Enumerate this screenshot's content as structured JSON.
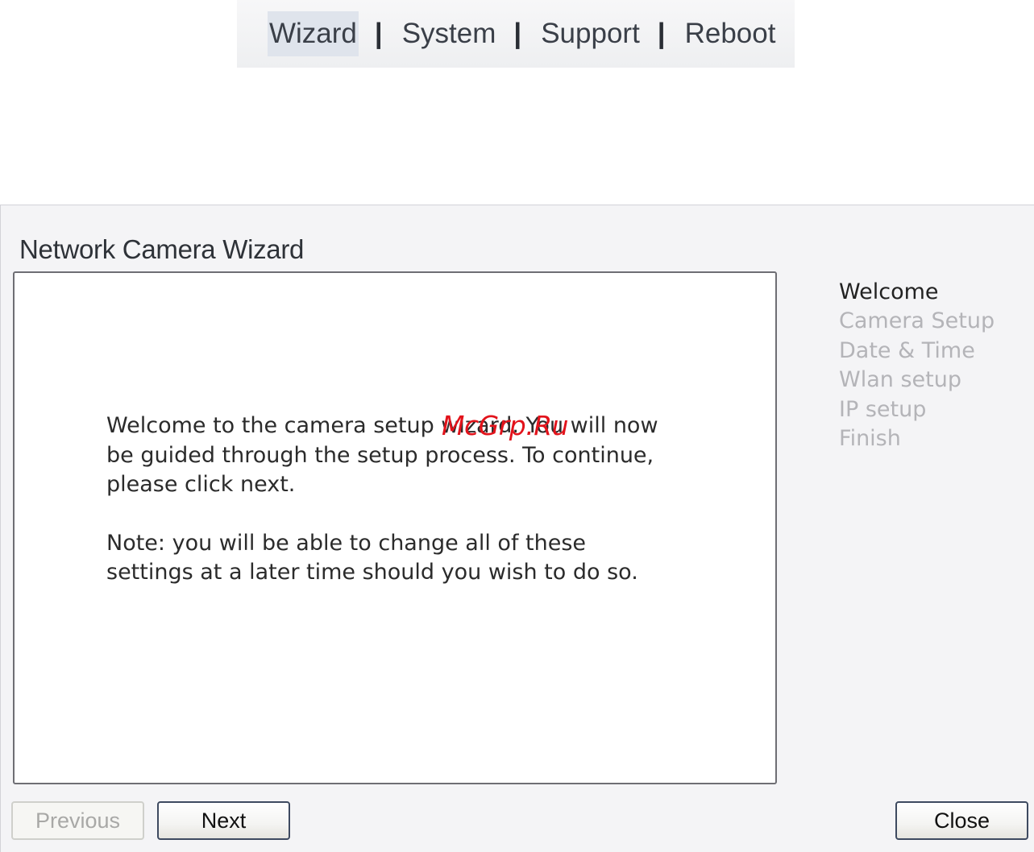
{
  "topnav": {
    "items": [
      {
        "label": "Wizard"
      },
      {
        "label": "System"
      },
      {
        "label": "Support"
      },
      {
        "label": "Reboot"
      }
    ],
    "separator": "|",
    "active_item": "Wizard"
  },
  "wizard": {
    "title": "Network Camera Wizard",
    "content": {
      "paragraph1": "Welcome to the camera setup wizard. You will now be guided through the setup process. To continue, please click next.",
      "paragraph2": "Note: you will be able to change all of these settings at a later time should you wish to do so."
    },
    "steps": [
      {
        "label": "Welcome"
      },
      {
        "label": "Camera Setup"
      },
      {
        "label": "Date & Time"
      },
      {
        "label": "Wlan setup"
      },
      {
        "label": "IP setup"
      },
      {
        "label": "Finish"
      }
    ],
    "current_step": "Welcome",
    "buttons": {
      "previous_label": "Previous",
      "next_label": "Next",
      "close_label": "Close"
    }
  },
  "watermark": "McGrp.Ru",
  "colors": {
    "active_nav_bg": "#dfe4ec",
    "step_inactive": "#b4b4b8",
    "step_active": "#222222",
    "watermark": "#e2131b"
  }
}
